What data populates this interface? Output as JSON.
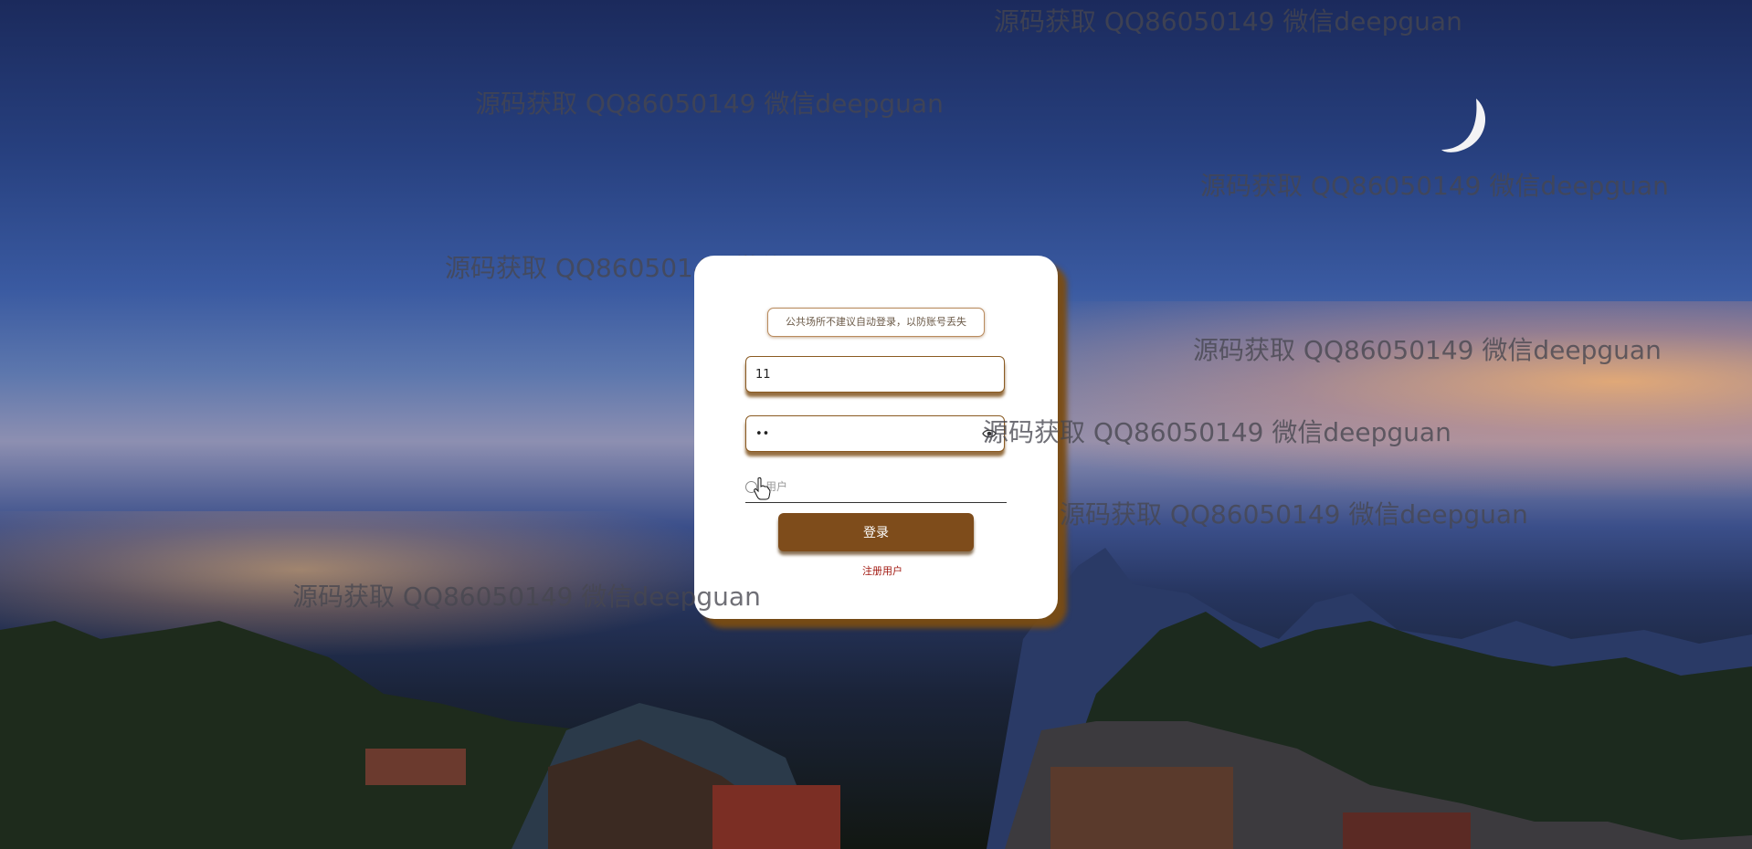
{
  "watermark_text": "源码获取 QQ86050149 微信deepguan",
  "login": {
    "notice": "公共场所不建议自动登录，以防账号丢失",
    "username_value": "11",
    "password_value": "••",
    "role_option_label": "用户",
    "login_button_label": "登录",
    "register_link_label": "注册用户"
  },
  "colors": {
    "card_shadow": "#7a4c12",
    "button_bg": "#7e4c1b",
    "link": "#a21a12"
  }
}
